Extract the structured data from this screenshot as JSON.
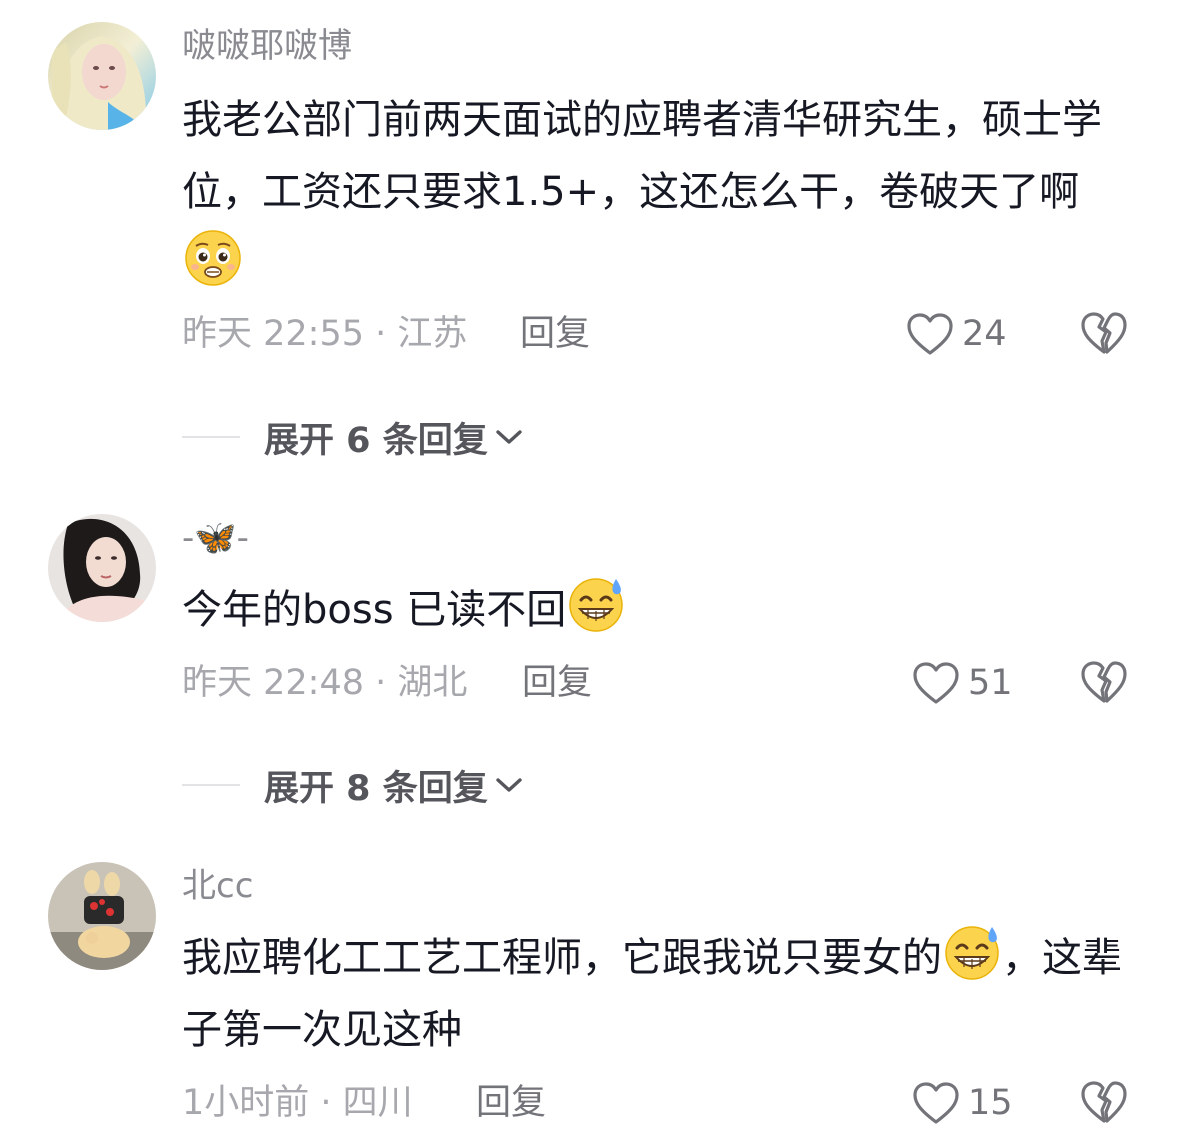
{
  "comments": [
    {
      "username": "啵啵耶啵博",
      "text": "我老公部门前两天面试的应聘者清华研究生，硕士学位，工资还只要求1.5+，这还怎么干，卷破天了啊",
      "emoji": "pleading-face-emoji",
      "meta": "昨天 22:55 · 江苏",
      "reply_label": "回复",
      "likes": "24",
      "expand_label": "展开 6 条回复"
    },
    {
      "username": "-🦋-",
      "text": "今年的boss 已读不回",
      "emoji": "grinning-sweat-emoji",
      "meta": "昨天 22:48 · 湖北",
      "reply_label": "回复",
      "likes": "51",
      "expand_label": "展开 8 条回复"
    },
    {
      "username": "北cc",
      "text_part1": "我应聘化工工艺工程师，它跟我说只要女的",
      "emoji": "grinning-sweat-emoji",
      "text_part2": "，这辈子第一次见这种",
      "meta": "1小时前 · 四川",
      "reply_label": "回复",
      "likes": "15"
    }
  ],
  "icons": {
    "like": "heart-outline-icon",
    "dislike": "broken-heart-icon",
    "expand": "chevron-down-icon"
  },
  "colors": {
    "text": "#161823",
    "muted": "#a7a8ad",
    "username": "#8a8b91",
    "icon": "#73747a"
  }
}
